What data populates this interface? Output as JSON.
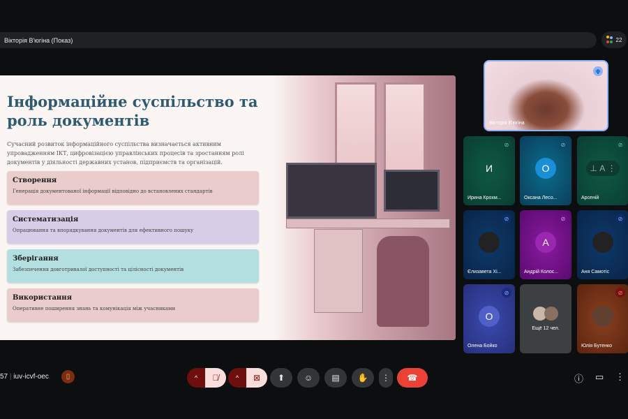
{
  "header": {
    "presenter_label": "Вікторія В'югіна (Показ)",
    "participant_count": "22"
  },
  "slide": {
    "title": "Інформаційне суспільство та роль документів",
    "intro": "Сучасний розвиток інформаційного суспільства визначається активним упровадженням ІКТ, цифровізацією управлінських процесів та зростанням ролі документів у діяльності державних установ, підприємств та організацій.",
    "cards": [
      {
        "title": "Створення",
        "text": "Генерація документованої інформації відповідно до встановлених стандартів",
        "color": "#ebcccd"
      },
      {
        "title": "Систематизація",
        "text": "Опрацювання та впорядкування документів для ефективного пошуку",
        "color": "#d8cde6"
      },
      {
        "title": "Зберігання",
        "text": "Забезпечення довготривалої доступності та цілісності документів",
        "color": "#b4dfe0"
      },
      {
        "title": "Використання",
        "text": "Оперативне поширення знань та комунікація між учасниками",
        "color": "#ebcccd"
      }
    ]
  },
  "self_view": {
    "name": "Вікторія В'югіна"
  },
  "tiles": [
    {
      "name": "Ирина Крохм...",
      "avatar": "И"
    },
    {
      "name": "Оксана Лесо...",
      "avatar": "О"
    },
    {
      "name": "Арсеній",
      "avatar": "А"
    },
    {
      "name": "Єлизавета Хі..."
    },
    {
      "name": "Андрій Колос...",
      "avatar": "А"
    },
    {
      "name": "Аня Самотіс"
    },
    {
      "name": "Олена Бойко",
      "avatar": "О"
    },
    {
      "name": "Ещё 12 чел."
    },
    {
      "name": "Юлія Бутенко"
    }
  ],
  "footer": {
    "time_fragment": "57",
    "meeting_code": "iuv-icvf-oec"
  }
}
